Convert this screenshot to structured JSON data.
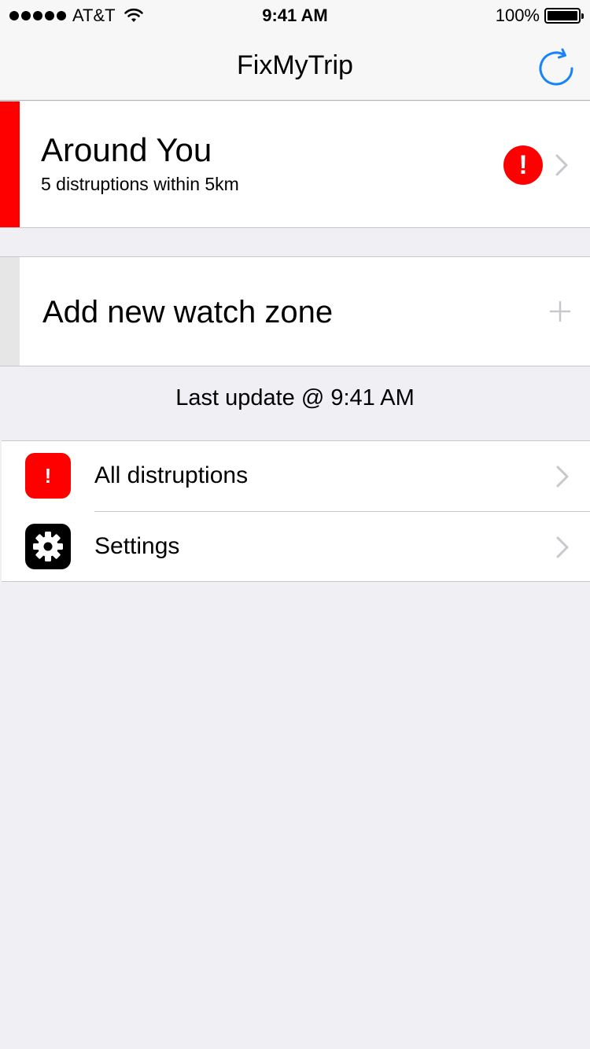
{
  "status_bar": {
    "carrier": "AT&T",
    "time": "9:41 AM",
    "battery": "100%"
  },
  "nav": {
    "title": "FixMyTrip",
    "refresh_icon": "refresh-icon"
  },
  "around_you": {
    "title": "Around You",
    "subtitle": "5 distruptions within 5km",
    "alert_glyph": "!",
    "accent_color": "#ff0000"
  },
  "add_zone": {
    "label": "Add new watch zone"
  },
  "last_update": "Last update @ 9:41 AM",
  "menu": {
    "items": [
      {
        "label": "All distruptions",
        "icon": "alert-icon",
        "icon_glyph": "!"
      },
      {
        "label": "Settings",
        "icon": "gear-icon"
      }
    ]
  },
  "colors": {
    "accent_blue": "#1a82fb",
    "alert_red": "#ff0000",
    "background": "#efeff4"
  }
}
